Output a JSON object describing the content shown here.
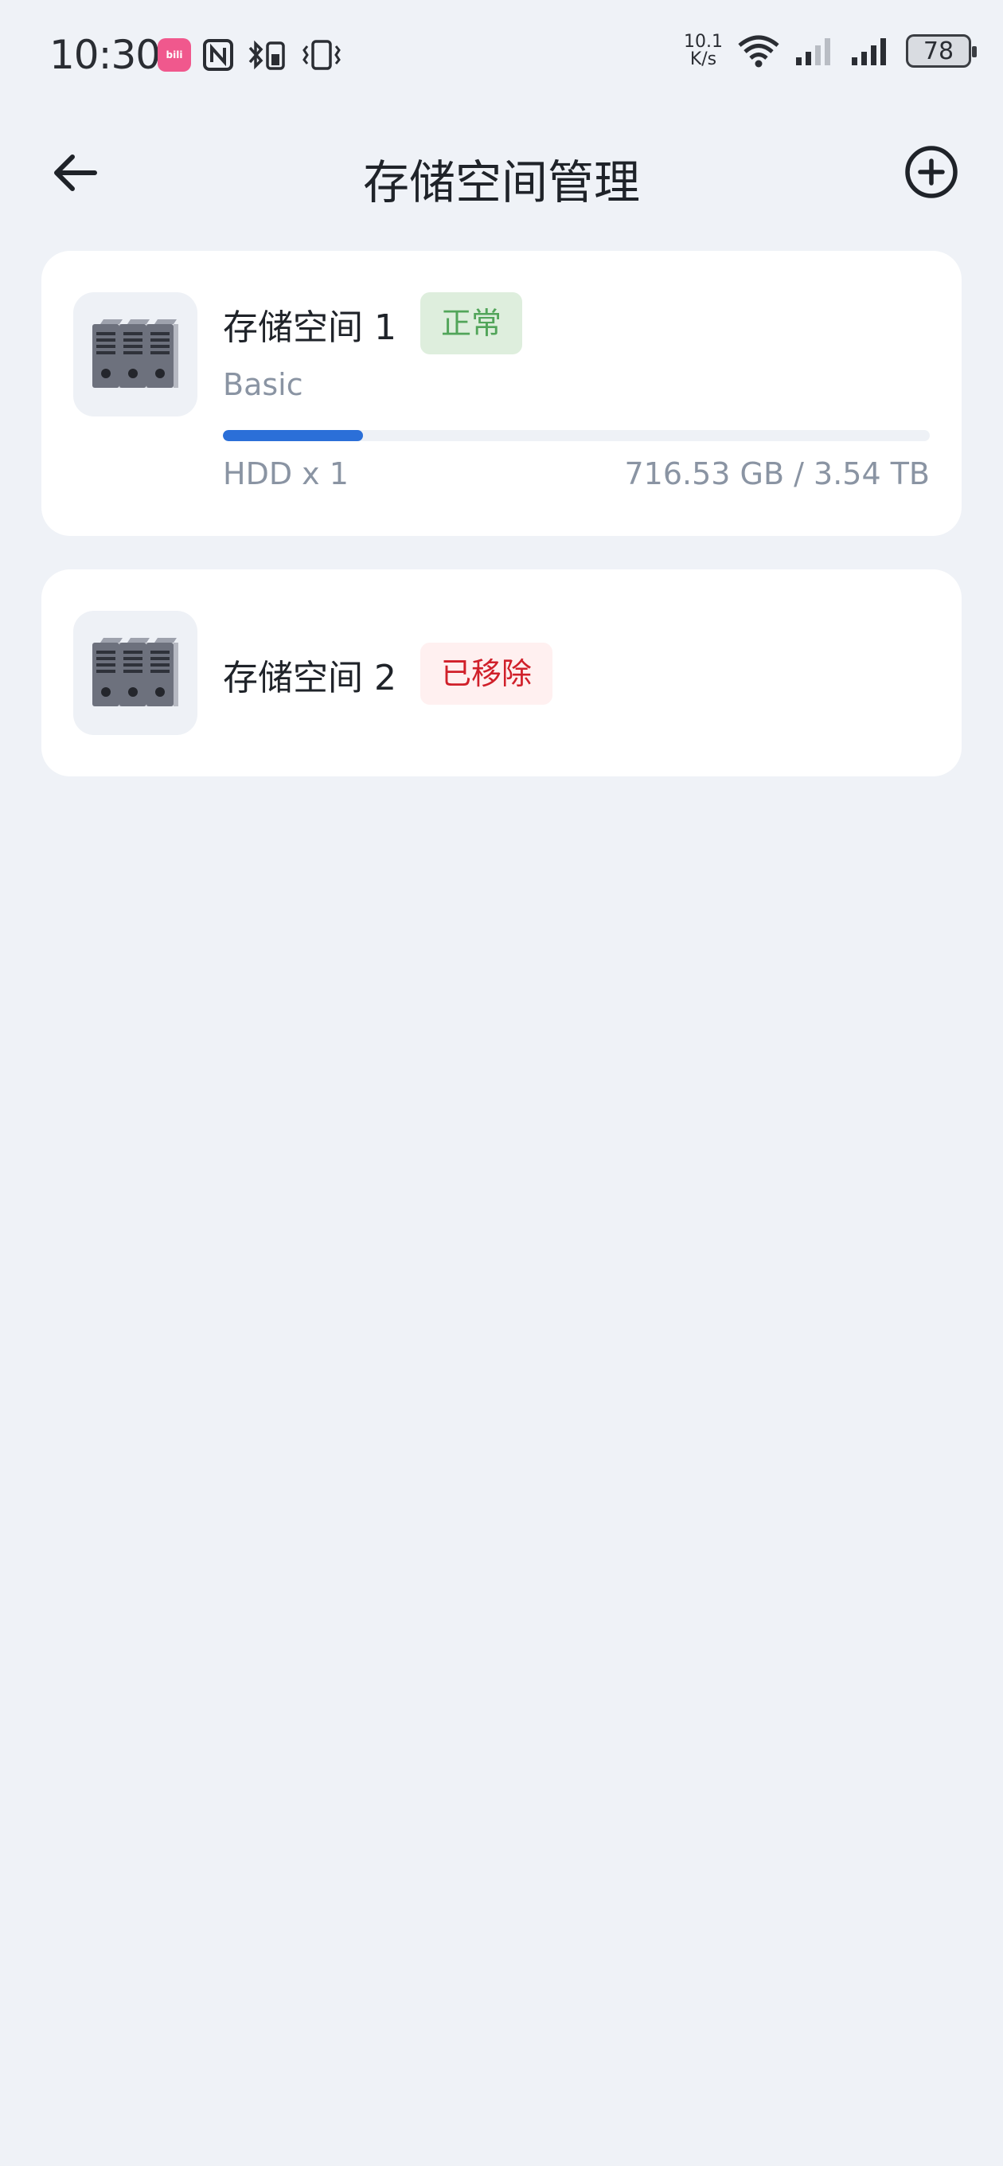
{
  "status_bar": {
    "time": "10:30",
    "network_speed_value": "10.1",
    "network_speed_unit": "K/s",
    "battery": "78"
  },
  "header": {
    "title": "存储空间管理",
    "back_icon": "arrow-left-icon",
    "add_icon": "plus-circle-icon"
  },
  "storage_pools": [
    {
      "name": "存储空间 1",
      "status": "正常",
      "status_color": "#52a55a",
      "type": "Basic",
      "usage_fraction": 0.198,
      "disks": "HDD x 1",
      "capacity": "716.53 GB / 3.54 TB",
      "icon": "server-rack-icon"
    },
    {
      "name": "存储空间 2",
      "status": "已移除",
      "status_color": "#d0202a",
      "icon": "server-rack-icon"
    }
  ],
  "colors": {
    "accent": "#2b6fd8",
    "background": "#eff2f7"
  }
}
